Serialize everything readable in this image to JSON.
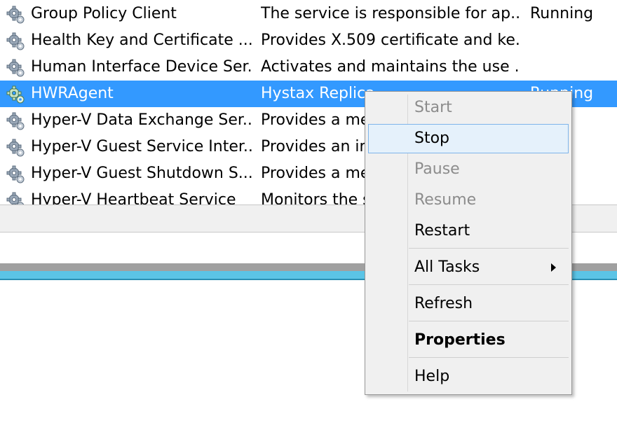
{
  "services": {
    "rows": [
      {
        "name": "Group Policy Client",
        "description": "The service is responsible for ap...",
        "status": "Running",
        "icon": "gear-icon"
      },
      {
        "name": "Health Key and Certificate ...",
        "description": "Provides X.509 certificate and ke...",
        "status": "",
        "icon": "gear-icon"
      },
      {
        "name": "Human Interface Device Ser...",
        "description": "Activates and maintains the use ...",
        "status": "",
        "icon": "gear-icon"
      },
      {
        "name": "HWRAgent",
        "description": "Hystax Replica",
        "status": "Running",
        "icon": "gear-icon",
        "selected": true
      },
      {
        "name": "Hyper-V Data Exchange Ser...",
        "description": "Provides a me",
        "status": "",
        "icon": "gear-icon"
      },
      {
        "name": "Hyper-V Guest Service Inter...",
        "description": "Provides an in",
        "status": "",
        "icon": "gear-icon"
      },
      {
        "name": "Hyper-V Guest Shutdown S...",
        "description": "Provides a me",
        "status": "",
        "icon": "gear-icon"
      },
      {
        "name": "Hyper-V Heartbeat Service",
        "description": "Monitors the s",
        "status": "",
        "icon": "gear-icon"
      }
    ]
  },
  "context_menu": {
    "items": {
      "start": "Start",
      "stop": "Stop",
      "pause": "Pause",
      "resume": "Resume",
      "restart": "Restart",
      "all_tasks": "All Tasks",
      "refresh": "Refresh",
      "properties": "Properties",
      "help": "Help"
    }
  },
  "colors": {
    "selection": "#3399ff",
    "menu_hover": "#e5f1fb",
    "accent_band": "#5bc4e6"
  }
}
